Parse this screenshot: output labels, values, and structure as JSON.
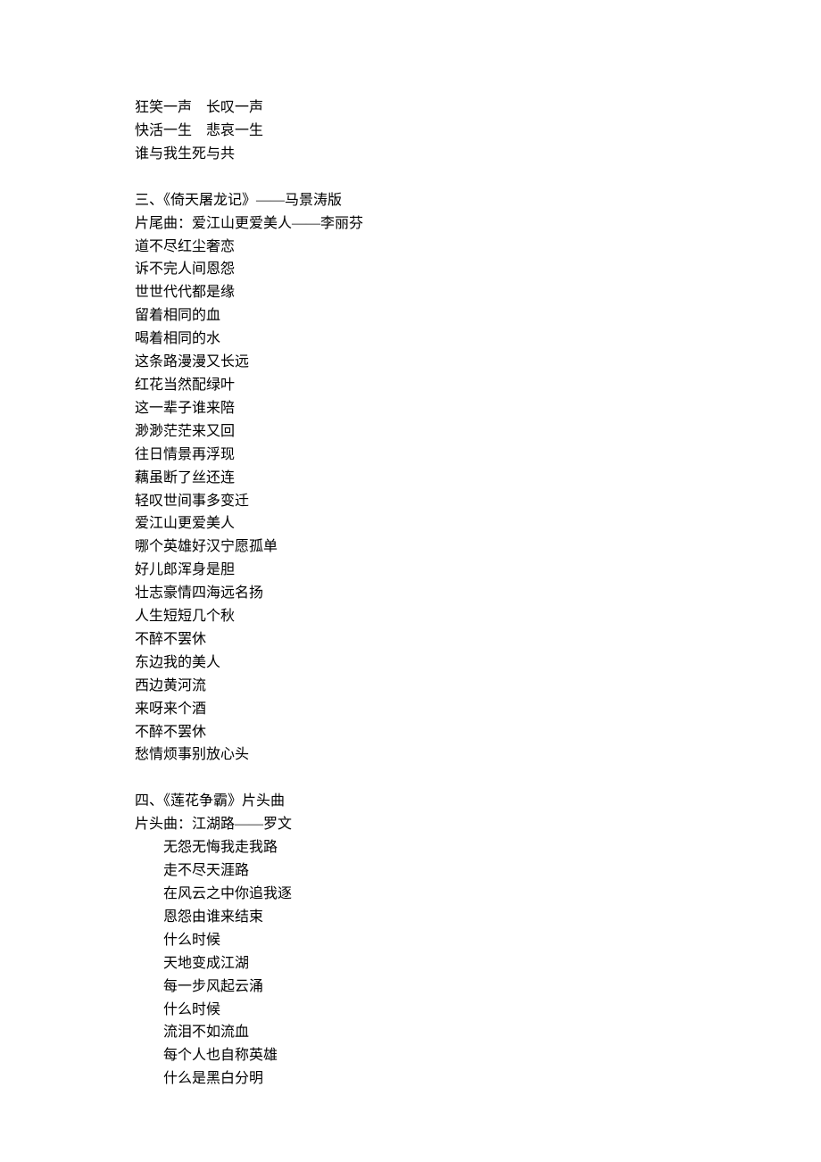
{
  "block1": {
    "lines": [
      "狂笑一声    长叹一声",
      "快活一生    悲哀一生",
      "谁与我生死与共"
    ]
  },
  "section3": {
    "heading": "三、《倚天屠龙记》——马景涛版",
    "subheading": "片尾曲：爱江山更爱美人——李丽芬",
    "lines": [
      "道不尽红尘奢恋",
      "诉不完人间恩怨",
      "世世代代都是缘",
      "留着相同的血",
      "喝着相同的水",
      "这条路漫漫又长远",
      "红花当然配绿叶",
      "这一辈子谁来陪",
      "渺渺茫茫来又回",
      "往日情景再浮现",
      "藕虽断了丝还连",
      "轻叹世间事多变迁",
      "爱江山更爱美人",
      "哪个英雄好汉宁愿孤单",
      "好儿郎浑身是胆",
      "壮志豪情四海远名扬",
      "人生短短几个秋",
      "不醉不罢休",
      "东边我的美人",
      "西边黄河流",
      "来呀来个酒",
      "不醉不罢休",
      "愁情烦事别放心头"
    ]
  },
  "section4": {
    "heading": "四、《莲花争霸》片头曲",
    "subheading": "片头曲：江湖路——罗文",
    "lines": [
      "无怨无悔我走我路",
      "走不尽天涯路",
      "在风云之中你追我逐",
      "恩怨由谁来结束",
      "什么时候",
      "天地变成江湖",
      "每一步风起云涌",
      "什么时候",
      "流泪不如流血",
      "每个人也自称英雄",
      "什么是黑白分明"
    ]
  }
}
